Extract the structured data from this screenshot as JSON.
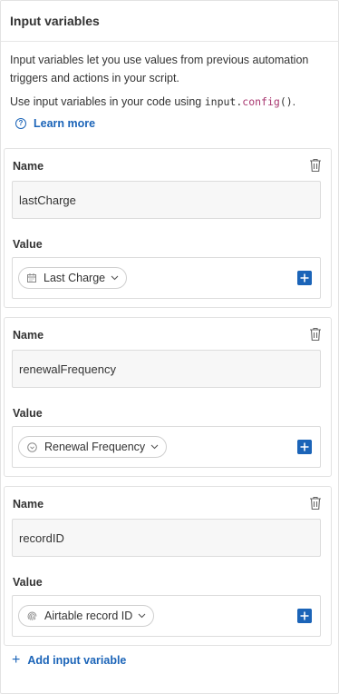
{
  "header": {
    "title": "Input variables"
  },
  "intro": {
    "description": "Input variables let you use values from previous automation triggers and actions in your script.",
    "usage_prefix": "Use input variables in your code using ",
    "code_obj": "input.",
    "code_method": "config",
    "code_parens": "()",
    "usage_suffix": ".",
    "learn_more": "Learn more"
  },
  "variables": [
    {
      "name_label": "Name",
      "name_value": "lastCharge",
      "value_label": "Value",
      "field": "Last Charge",
      "field_icon": "calendar-icon"
    },
    {
      "name_label": "Name",
      "name_value": "renewalFrequency",
      "value_label": "Value",
      "field": "Renewal Frequency",
      "field_icon": "single-select-icon"
    },
    {
      "name_label": "Name",
      "name_value": "recordID",
      "value_label": "Value",
      "field": "Airtable record ID",
      "field_icon": "fingerprint-icon"
    }
  ],
  "footer": {
    "add_variable": "Add input variable"
  },
  "colors": {
    "accent": "#1b64b8",
    "border": "#e2e2e2",
    "input_bg": "#f7f7f7"
  }
}
